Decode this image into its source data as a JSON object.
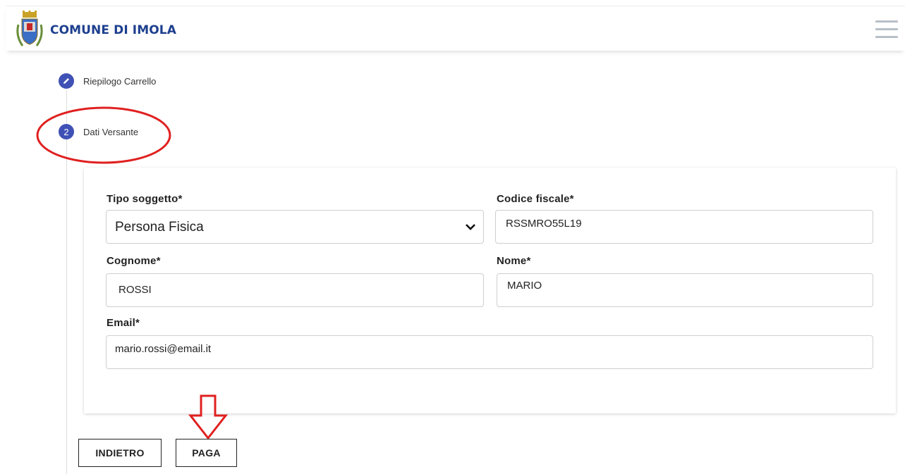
{
  "header": {
    "brand": "COMUNE DI IMOLA",
    "logo_icon": "coat-of-arms-icon",
    "menu_icon": "hamburger-menu-icon",
    "brand_color": "#1d3f8f"
  },
  "steps": [
    {
      "icon": "pencil-icon",
      "label": "Riepilogo Carrello"
    },
    {
      "number": "2",
      "label": "Dati Versante"
    }
  ],
  "form": {
    "tipo_soggetto": {
      "label": "Tipo soggetto*",
      "value": "Persona Fisica"
    },
    "codice_fiscale": {
      "label": "Codice fiscale*",
      "value": "RSSMRO55L19"
    },
    "cognome": {
      "label": "Cognome*",
      "value": "ROSSI"
    },
    "nome": {
      "label": "Nome*",
      "value": "MARIO"
    },
    "email": {
      "label": "Email*",
      "value": "mario.rossi@email.it"
    }
  },
  "buttons": {
    "back": "INDIETRO",
    "pay": "PAGA"
  },
  "colors": {
    "step_accent": "#3f51b5",
    "annotation_red": "#e02020"
  }
}
